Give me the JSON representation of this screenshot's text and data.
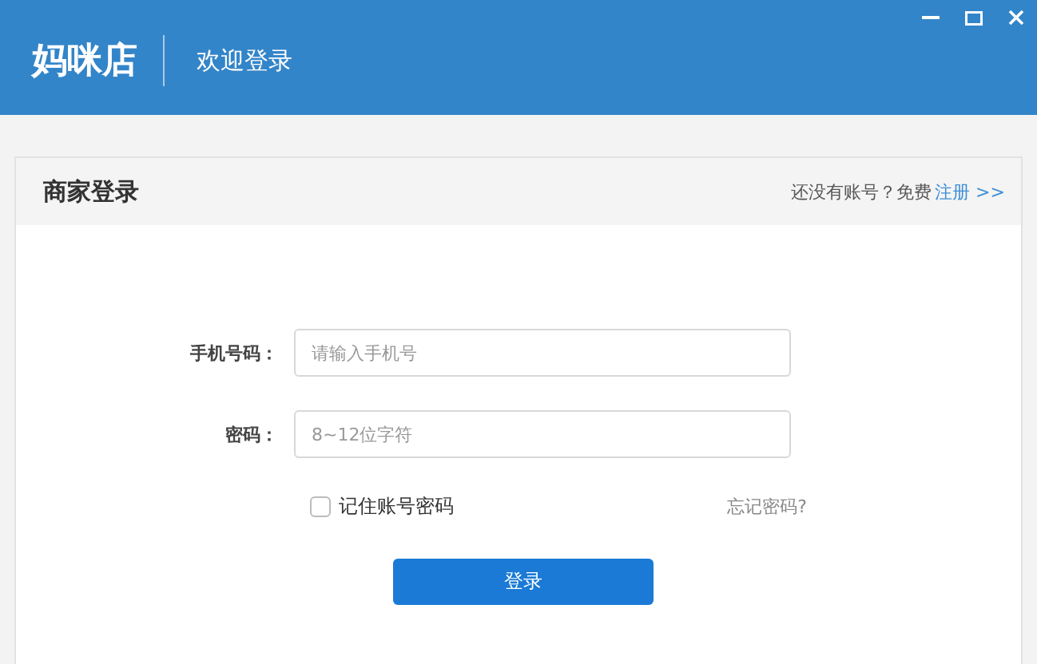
{
  "header": {
    "logo": "妈咪店",
    "subtitle": "欢迎登录"
  },
  "panel": {
    "title": "商家登录",
    "register_prompt": "还没有账号？免费",
    "register_link": "注册 >>"
  },
  "fields": [
    {
      "label": "手机号码：",
      "placeholder": "请输入手机号"
    },
    {
      "label": "密码：",
      "placeholder": "8~12位字符"
    }
  ],
  "remember": {
    "label": "记住账号密码",
    "checked": false
  },
  "forgot_link": "忘记密码?",
  "login_button": "登录"
}
